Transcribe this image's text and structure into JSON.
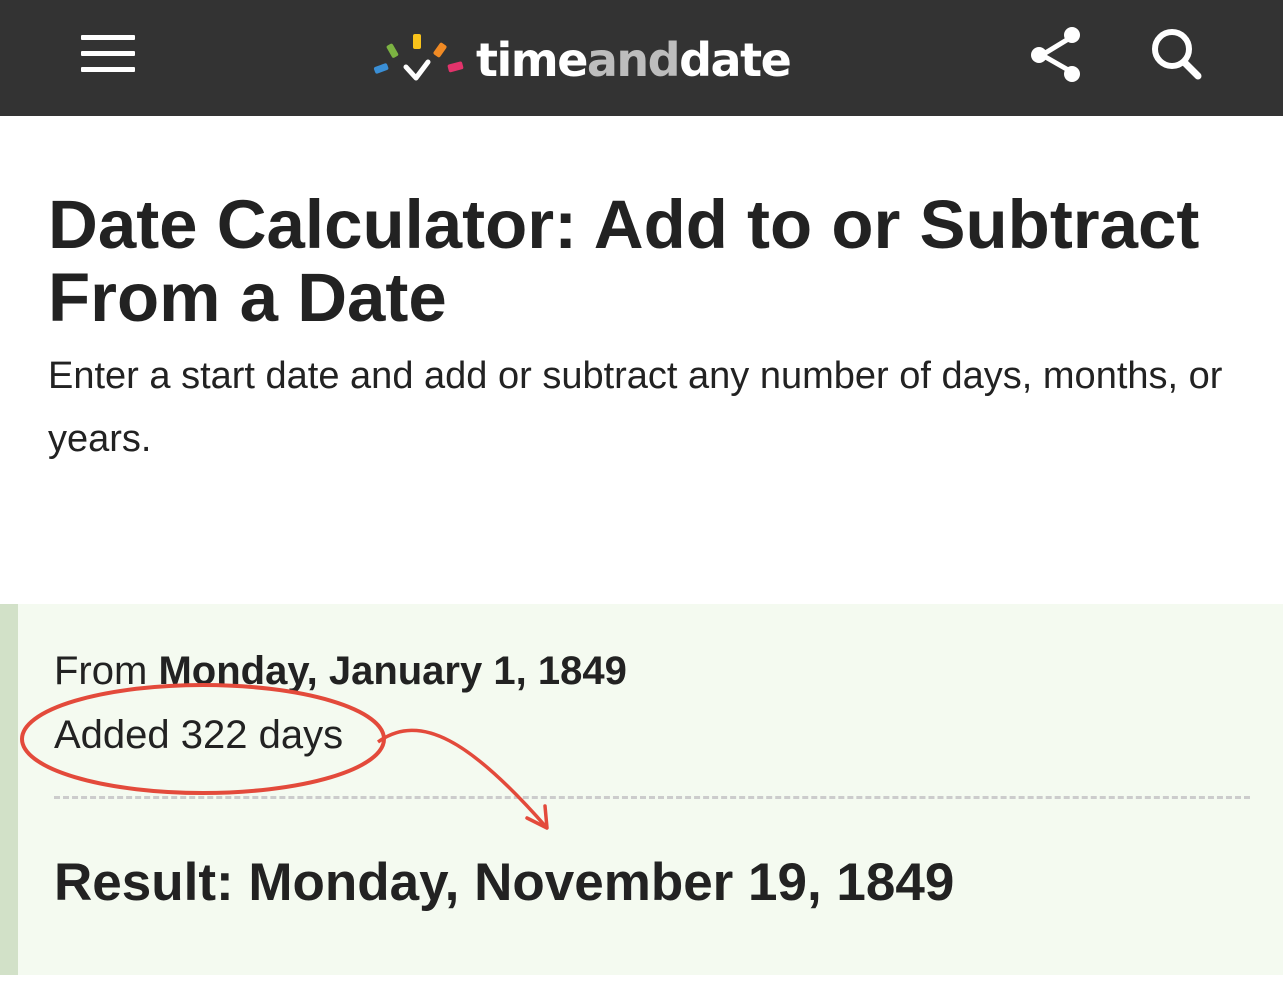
{
  "header": {
    "logo": {
      "text_time": "time",
      "text_and": "and",
      "text_date": "date"
    },
    "menu_icon": "hamburger-menu-icon",
    "share_icon": "share-icon",
    "search_icon": "search-icon"
  },
  "page": {
    "title": "Date Calculator: Add to or Subtract From a Date",
    "intro": "Enter a start date and add or subtract any number of days, months, or years."
  },
  "result": {
    "from_prefix": "From",
    "from_date": "Monday, January 1, 1849",
    "added_text": "Added 322 days",
    "result_text": "Result: Monday, November 19, 1849"
  },
  "colors": {
    "header_bg": "#333333",
    "result_bg": "#f4faf0",
    "result_border": "#d2e1c8",
    "annotation": "#e34a3b"
  }
}
